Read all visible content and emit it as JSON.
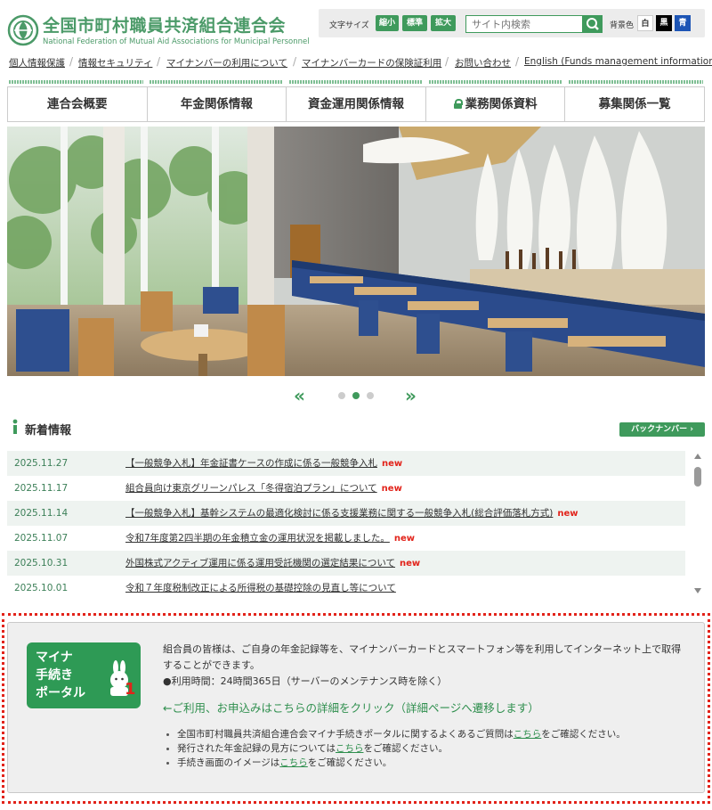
{
  "header": {
    "title": "全国市町村職員共済組合連合会",
    "subtitle": "National Federation of Mutual Aid Associations for Municipal Personnel"
  },
  "toolbox": {
    "font_size_label": "文字サイズ",
    "font_sizes": [
      "縮小",
      "標準",
      "拡大"
    ],
    "search_placeholder": "サイト内検索",
    "bg_label": "背景色",
    "bg_options": [
      "白",
      "黒",
      "青"
    ]
  },
  "utility_nav": [
    "個人情報保護",
    "情報セキュリティ",
    "マイナンバーの利用について",
    "マイナンバーカードの保険証利用",
    "お問い合わせ",
    "English (Funds management information)"
  ],
  "global_nav": [
    "連合会概要",
    "年金関係情報",
    "資金運用関係情報",
    "業務関係資料",
    "募集関係一覧"
  ],
  "slider": {
    "prev": "«",
    "next": "»",
    "slide_count": 3,
    "active_index": 1
  },
  "news": {
    "title": "新着情報",
    "back_number": "バックナンバー",
    "new_label": "new",
    "items": [
      {
        "date": "2025.11.27",
        "text": "【一般競争入札】年金証書ケースの作成に係る一般競争入札",
        "is_new": true
      },
      {
        "date": "2025.11.17",
        "text": "組合員向け東京グリーンパレス「冬得宿泊プラン」について",
        "is_new": true
      },
      {
        "date": "2025.11.14",
        "text": "【一般競争入札】基幹システムの最適化検討に係る支援業務に関する一般競争入札(総合評価落札方式)",
        "is_new": true
      },
      {
        "date": "2025.11.07",
        "text": "令和7年度第2四半期の年金積立金の運用状況を掲載しました。",
        "is_new": true
      },
      {
        "date": "2025.10.31",
        "text": "外国株式アクティブ運用に係る運用受託機関の選定結果について",
        "is_new": true
      },
      {
        "date": "2025.10.01",
        "text": "令和７年度税制改正による所得税の基礎控除の見直し等について",
        "is_new": false
      }
    ]
  },
  "portal": {
    "logo_lines": [
      "マイナ",
      "手続き",
      "ポータル"
    ],
    "logo_number": "1",
    "description": "組合員の皆様は、ご自身の年金記録等を、マイナンバーカードとスマートフォン等を利用してインターネット上で取得することができます。",
    "hours": "●利用時間：24時間365日（サーバーのメンテナンス時を除く）",
    "cta": "←ご利用、お申込みはこちらの詳細をクリック（詳細ページへ遷移します）",
    "bullets": [
      {
        "before": "全国市町村職員共済組合連合会マイナ手続きポータルに関するよくあるご質問は",
        "link": "こちら",
        "after": "をご確認ください。"
      },
      {
        "before": "発行された年金記録の見方については",
        "link": "こちら",
        "after": "をご確認ください。"
      },
      {
        "before": "手続き画面のイメージは",
        "link": "こちら",
        "after": "をご確認ください。"
      }
    ]
  },
  "colors": {
    "brand": "#3f9a5c",
    "new": "#e2231a",
    "date": "#3b7f57",
    "frame": "#e2231a"
  }
}
